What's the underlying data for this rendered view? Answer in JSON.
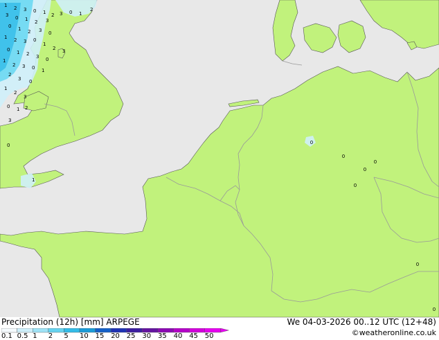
{
  "map": {
    "colors": {
      "sea": "#e8e8e8",
      "land": "#c1f27c",
      "border": "#999999",
      "coast": "#555555",
      "precip_light": "#cfeff9",
      "precip_mid": "#66d7f2",
      "precip_heavy": "#33bce8"
    },
    "value_labels": [
      "0",
      "0",
      "0",
      "0",
      "0",
      "0",
      "0"
    ],
    "cluster_numbers": [
      "1",
      "2",
      "3",
      "0"
    ]
  },
  "footer": {
    "title": "Precipitation (12h) [mm] ARPEGE",
    "datetime": "We 04-03-2026 00..12 UTC (12+48)",
    "credit": "©weatheronline.co.uk"
  },
  "legend": {
    "labels": [
      "0.1",
      "0.5",
      "1",
      "2",
      "5",
      "10",
      "15",
      "20",
      "25",
      "30",
      "35",
      "40",
      "45",
      "50"
    ],
    "colors": [
      "#f5fbfe",
      "#cdeffa",
      "#9fe3f6",
      "#66d3f0",
      "#33bce8",
      "#1a9bd8",
      "#1460c8",
      "#1e32b4",
      "#3c1ea0",
      "#6414a0",
      "#8c0ab4",
      "#b400c8",
      "#d200dc",
      "#e600f0"
    ]
  }
}
